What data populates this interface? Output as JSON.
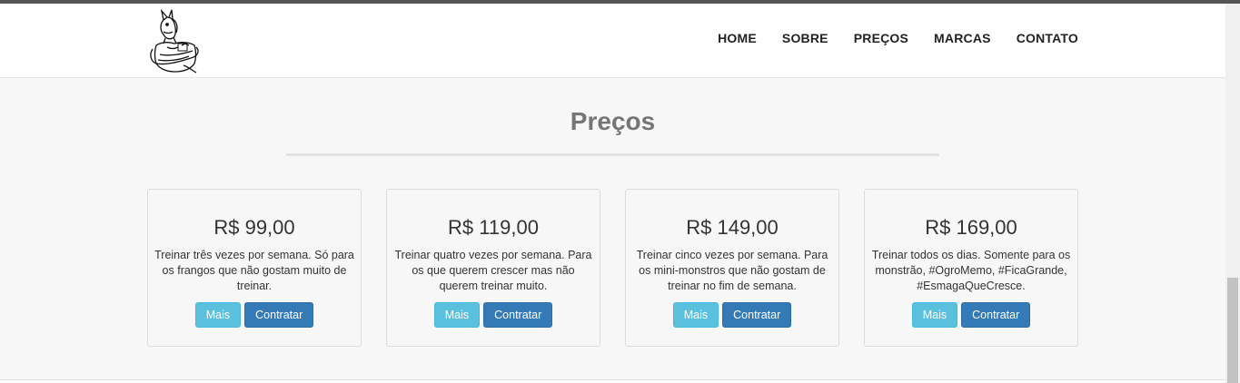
{
  "header": {
    "logo_icon": "cartoon-horse-mascot",
    "nav": [
      "HOME",
      "SOBRE",
      "PREÇOS",
      "MARCAS",
      "CONTATO"
    ]
  },
  "section": {
    "title": "Preços"
  },
  "plans": [
    {
      "price": "R$ 99,00",
      "description": "Treinar três vezes por semana. Só para os frangos que não gostam muito de treinar.",
      "more_label": "Mais",
      "hire_label": "Contratar"
    },
    {
      "price": "R$ 119,00",
      "description": "Treinar quatro vezes por semana. Para os que querem crescer mas não querem treinar muito.",
      "more_label": "Mais",
      "hire_label": "Contratar"
    },
    {
      "price": "R$ 149,00",
      "description": "Treinar cinco vezes por semana. Para os mini-monstros que não gostam de treinar no fim de semana.",
      "more_label": "Mais",
      "hire_label": "Contratar"
    },
    {
      "price": "R$ 169,00",
      "description": "Treinar todos os dias. Somente para os monstrão, #OgroMemo, #FicaGrande, #EsmagaQueCresce.",
      "more_label": "Mais",
      "hire_label": "Contratar"
    }
  ],
  "colors": {
    "info_button": "#5bc0de",
    "primary_button": "#337ab7",
    "title": "#757575",
    "background": "#f7f7f7"
  }
}
